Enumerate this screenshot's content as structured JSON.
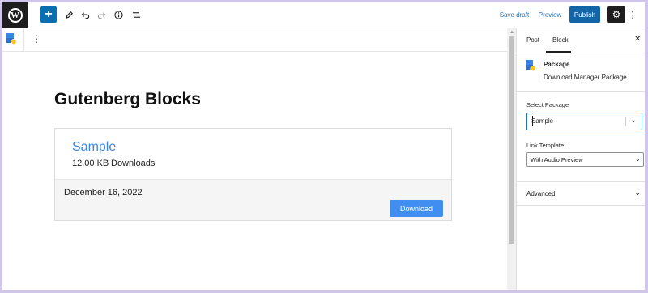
{
  "toolbar": {
    "add_icon": "plus-icon",
    "tools_icon": "pencil-icon",
    "undo_icon": "undo-icon",
    "redo_icon": "redo-icon",
    "details_icon": "info-icon",
    "list_view_icon": "list-view-icon",
    "save_draft_label": "Save draft",
    "preview_label": "Preview",
    "publish_label": "Publish",
    "settings_icon": "gear-icon",
    "options_icon": "kebab-icon"
  },
  "content": {
    "title": "Gutenberg Blocks",
    "package": {
      "name": "Sample",
      "size": "12.00 KB",
      "downloads_label": "Downloads",
      "date": "December 16, 2022",
      "download_button": "Download"
    }
  },
  "sidebar": {
    "tabs": [
      {
        "label": "Post",
        "active": false
      },
      {
        "label": "Block",
        "active": true
      }
    ],
    "block": {
      "title": "Package",
      "description": "Download Manager Package"
    },
    "select_package_label": "Select Package",
    "select_package_value": "Sample",
    "link_template_label": "Link Template:",
    "link_template_value": "With Audio Preview",
    "advanced_label": "Advanced"
  },
  "colors": {
    "accent": "#3a86e8",
    "publish": "#1464a8",
    "download_button": "#3f8ef0"
  }
}
